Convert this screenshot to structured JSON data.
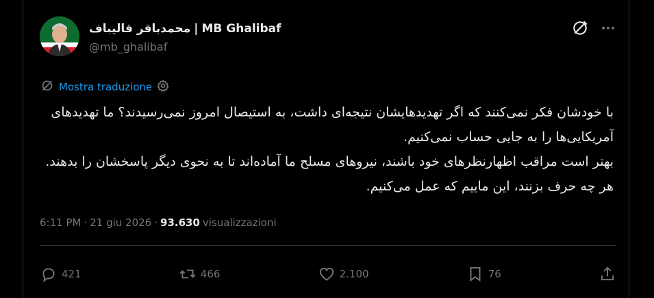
{
  "author": {
    "name_fa": "محمدباقر قالیباف",
    "separator": "|",
    "name_en": "MB Ghalibaf",
    "handle": "@mb_ghalibaf"
  },
  "translation": {
    "label": "Mostra traduzione"
  },
  "tweet": {
    "paragraphs": [
      "با خودشان فکر نمی‌کنند که اگر تهدیدهایشان نتیجه‌ای داشت، به استیصال امروز نمی‌رسیدند؟ ما تهدیدهای آمریکایی‌ها را به جایی حساب نمی‌کنیم.",
      "بهتر است مراقب اظهارنظرهای خود باشند، نیروهای مسلح ما آماده‌اند تا به نحوی دیگر پاسخشان را بدهند. هر چه حرف بزنند، این ماییم که عمل می‌کنیم."
    ]
  },
  "meta": {
    "time": "6:11 PM",
    "dot1": "·",
    "date": "21 giu 2026",
    "dot2": "·",
    "views": "93.630",
    "views_label": "visualizzazioni"
  },
  "actions": {
    "replies": "421",
    "reposts": "466",
    "likes": "2.100",
    "bookmarks": "76"
  },
  "icons": {
    "grok": "grok-icon",
    "more": "more-icon",
    "translate": "translate-icon",
    "settings": "gear-icon"
  },
  "colors": {
    "accent": "#1d9bf0",
    "background": "#000000",
    "text": "#e7e9ea",
    "secondary": "#71767b"
  }
}
